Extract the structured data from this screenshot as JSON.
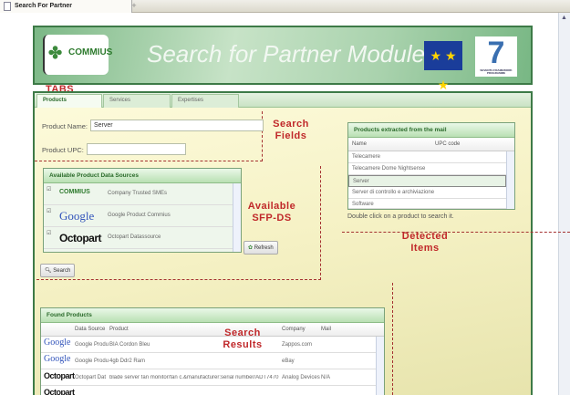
{
  "browser": {
    "tab_title": "Search For Partner",
    "new_tab": "+"
  },
  "header": {
    "logo_text": "COMMIUS",
    "title": "Search for Partner Module",
    "fp7_text": "SEVENTH FRAMEWORK PROGRAMME",
    "fp7_number": "7",
    "eu_stars": "★ ★ ★"
  },
  "annotations": {
    "tabs": "TABS",
    "search_fields": "Search Fields",
    "available": "Available SFP-DS",
    "detected": "Detected Items",
    "results": "Search Results"
  },
  "tabs": [
    {
      "label": "Products"
    },
    {
      "label": "Services"
    },
    {
      "label": "Expertises"
    }
  ],
  "search": {
    "name_label": "Product Name:",
    "name_value": "Server",
    "upc_label": "Product UPC:",
    "upc_value": "",
    "search_button": "Search",
    "refresh_button": "Refresh"
  },
  "sources": {
    "title": "Available Product Data Sources",
    "items": [
      {
        "logo": "COMMIUS",
        "description": "Company Trusted SMEs",
        "checked": true
      },
      {
        "logo": "Google",
        "description": "Google Product Commius",
        "checked": true
      },
      {
        "logo": "Octopart",
        "description": "Octopart Datassource",
        "checked": true
      }
    ]
  },
  "extracted": {
    "title": "Products extracted from the mail",
    "columns": [
      "Name",
      "UPC code"
    ],
    "rows": [
      "Telecamere",
      "Telecamere Dome Nightsense",
      "Server",
      "Server di controllo e archiviazione",
      "Software"
    ],
    "selected_index": 2,
    "hint": "Double click on a product to search it."
  },
  "found": {
    "title": "Found Products",
    "columns": [
      "Data Source",
      "Product",
      "Company",
      "Mail"
    ],
    "rows": [
      {
        "logo": "Google",
        "source": "Google Produ",
        "product": "BIA Cordon Bleu",
        "company": "Zappos.com",
        "mail": ""
      },
      {
        "logo": "Google",
        "source": "Google Produ",
        "product": "4gb Ddr2 Ram",
        "company": "eBay",
        "mail": ""
      },
      {
        "logo": "Octopart",
        "source": "Octopart Dat",
        "product": "blade server fan monitor/fan c.&manufacturer:serial number/ADT7470",
        "company": "Analog Devices",
        "mail": "N/A"
      },
      {
        "logo": "Octopart",
        "source": "",
        "product": "",
        "company": "",
        "mail": ""
      }
    ]
  }
}
